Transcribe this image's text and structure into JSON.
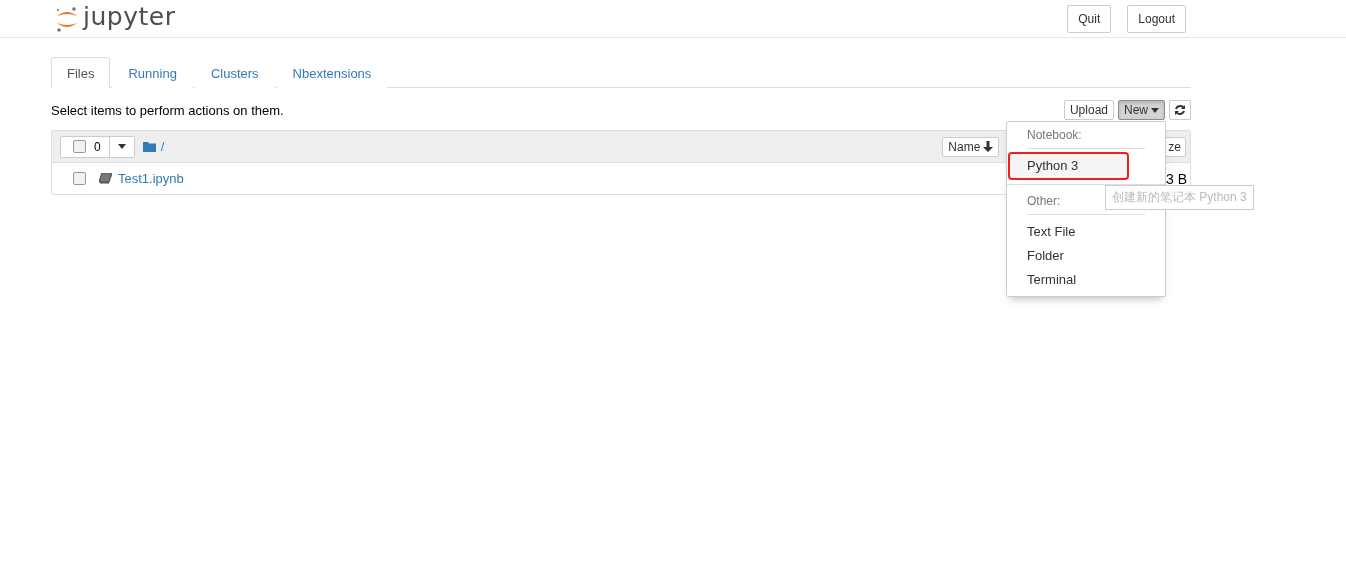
{
  "header": {
    "logo_text": "jupyter",
    "buttons": [
      "Quit",
      "Logout"
    ]
  },
  "tabs": [
    {
      "label": "Files",
      "selected": true
    },
    {
      "label": "Running",
      "selected": false
    },
    {
      "label": "Clusters",
      "selected": false
    },
    {
      "label": "Nbextensions",
      "selected": false
    }
  ],
  "toolbar": {
    "hint": "Select items to perform actions on them.",
    "upload": "Upload",
    "new": {
      "label": "New",
      "expanded": true
    }
  },
  "list_header": {
    "select_count": "0",
    "select_checked": false,
    "path": "/",
    "sort_button": "Name",
    "size_button": "ze"
  },
  "rows": [
    {
      "name": "Test1.ipynb",
      "checked": false,
      "size": "3 B"
    }
  ],
  "new_menu": {
    "sections": [
      {
        "header": "Notebook:",
        "items": [
          {
            "label": "Python 3",
            "selected": true
          }
        ]
      },
      {
        "header": "Other:",
        "items": [
          {
            "label": "Text File",
            "selected": false
          },
          {
            "label": "Folder",
            "selected": false
          },
          {
            "label": "Terminal",
            "selected": false
          }
        ]
      }
    ]
  },
  "tooltip": "创建新的笔记本 Python 3"
}
